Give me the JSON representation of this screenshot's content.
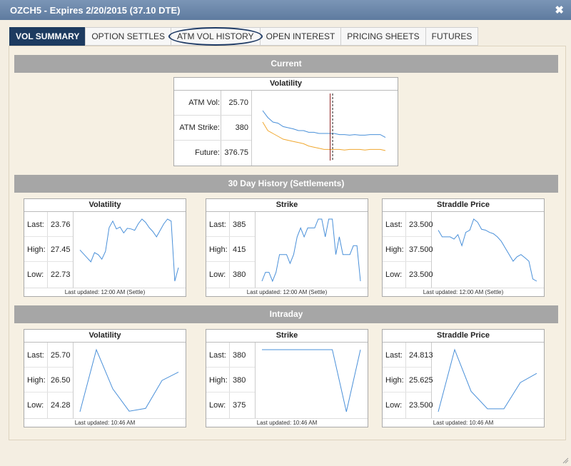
{
  "window": {
    "title": "OZCH5 - Expires 2/20/2015 (37.10 DTE)",
    "close_icon": "close-icon"
  },
  "tabs": [
    {
      "label": "VOL SUMMARY",
      "active": true
    },
    {
      "label": "OPTION SETTLES"
    },
    {
      "label": "ATM VOL HISTORY",
      "annotated": true
    },
    {
      "label": "OPEN INTEREST"
    },
    {
      "label": "PRICING SHEETS"
    },
    {
      "label": "FUTURES"
    }
  ],
  "sections": {
    "current": "Current",
    "history": "30 Day History (Settlements)",
    "intraday": "Intraday"
  },
  "current": {
    "title": "Volatility",
    "rows": [
      {
        "label": "ATM Vol:",
        "value": "25.70"
      },
      {
        "label": "ATM Strike:",
        "value": "380"
      },
      {
        "label": "Future:",
        "value": "376.75"
      }
    ],
    "colors": {
      "blue": "#4a90d9",
      "orange": "#f0a830",
      "marker_solid": "#8b1a1a",
      "marker_dashed": "#222222"
    }
  },
  "history_cards": [
    {
      "title": "Volatility",
      "stats": [
        {
          "label": "Last:",
          "value": "23.76"
        },
        {
          "label": "High:",
          "value": "27.45"
        },
        {
          "label": "Low:",
          "value": "22.73"
        }
      ],
      "footer": "Last updated: 12:00 AM (Settle)"
    },
    {
      "title": "Strike",
      "stats": [
        {
          "label": "Last:",
          "value": "385"
        },
        {
          "label": "High:",
          "value": "415"
        },
        {
          "label": "Low:",
          "value": "380"
        }
      ],
      "footer": "Last updated: 12:00 AM (Settle)"
    },
    {
      "title": "Straddle Price",
      "stats": [
        {
          "label": "Last:",
          "value": "23.500"
        },
        {
          "label": "High:",
          "value": "37.500"
        },
        {
          "label": "Low:",
          "value": "23.500"
        }
      ],
      "footer": "Last updated: 12:00 AM (Settle)"
    }
  ],
  "intraday_cards": [
    {
      "title": "Volatility",
      "stats": [
        {
          "label": "Last:",
          "value": "25.70"
        },
        {
          "label": "High:",
          "value": "26.50"
        },
        {
          "label": "Low:",
          "value": "24.28"
        }
      ],
      "footer": "Last updated: 10:46 AM"
    },
    {
      "title": "Strike",
      "stats": [
        {
          "label": "Last:",
          "value": "380"
        },
        {
          "label": "High:",
          "value": "380"
        },
        {
          "label": "Low:",
          "value": "375"
        }
      ],
      "footer": "Last updated: 10:46 AM"
    },
    {
      "title": "Straddle Price",
      "stats": [
        {
          "label": "Last:",
          "value": "24.813"
        },
        {
          "label": "High:",
          "value": "25.625"
        },
        {
          "label": "Low:",
          "value": "23.500"
        }
      ],
      "footer": "Last updated: 10:46 AM"
    }
  ],
  "chart_data": [
    {
      "type": "line",
      "name": "current-volatility-smile",
      "series": [
        {
          "values": [
            0.8,
            0.68,
            0.6,
            0.58,
            0.52,
            0.5,
            0.48,
            0.45,
            0.45,
            0.42,
            0.42,
            0.4,
            0.4,
            0.4,
            0.4,
            0.38,
            0.38,
            0.37,
            0.38,
            0.37,
            0.37,
            0.38,
            0.38,
            0.38,
            0.33
          ],
          "color": "#4a90d9"
        },
        {
          "values": [
            0.6,
            0.45,
            0.4,
            0.35,
            0.3,
            0.28,
            0.26,
            0.24,
            0.22,
            0.18,
            0.16,
            0.14,
            0.12,
            0.12,
            0.12,
            0.12,
            0.11,
            0.12,
            0.12,
            0.12,
            0.11,
            0.12,
            0.12,
            0.12,
            0.1
          ],
          "color": "#f0a830"
        }
      ],
      "markers": [
        0.55,
        0.57
      ]
    },
    {
      "type": "line",
      "name": "history-volatility",
      "values": [
        25.1,
        24.8,
        24.5,
        24.2,
        24.9,
        24.75,
        24.4,
        25.0,
        26.8,
        27.3,
        26.7,
        26.85,
        26.4,
        26.75,
        26.7,
        26.6,
        27.1,
        27.45,
        27.2,
        26.8,
        26.5,
        26.1,
        26.6,
        27.1,
        27.45,
        27.3,
        22.73,
        23.76
      ]
    },
    {
      "type": "line",
      "name": "history-strike",
      "values": [
        380,
        385,
        385,
        380,
        385,
        395,
        395,
        395,
        390,
        395,
        405,
        410,
        405,
        410,
        410,
        410,
        415,
        415,
        405,
        415,
        415,
        395,
        405,
        395,
        395,
        395,
        400,
        400,
        380
      ]
    },
    {
      "type": "line",
      "name": "history-straddle",
      "values": [
        35.0,
        33.5,
        33.5,
        33.5,
        33.0,
        34.0,
        31.5,
        34.5,
        35.0,
        37.5,
        36.8,
        35.2,
        35.0,
        34.5,
        34.2,
        33.5,
        32.5,
        31.0,
        29.5,
        28.0,
        29.0,
        29.5,
        28.8,
        28.0,
        24.0,
        23.5
      ]
    },
    {
      "type": "line",
      "name": "intraday-volatility",
      "values": [
        24.28,
        26.5,
        25.1,
        24.3,
        24.4,
        25.4,
        25.7
      ]
    },
    {
      "type": "line",
      "name": "intraday-strike",
      "values": [
        380,
        380,
        380,
        380,
        380,
        380,
        375,
        380
      ]
    },
    {
      "type": "line",
      "name": "intraday-straddle",
      "values": [
        23.5,
        25.625,
        24.2,
        23.6,
        23.6,
        24.5,
        24.813
      ]
    }
  ]
}
